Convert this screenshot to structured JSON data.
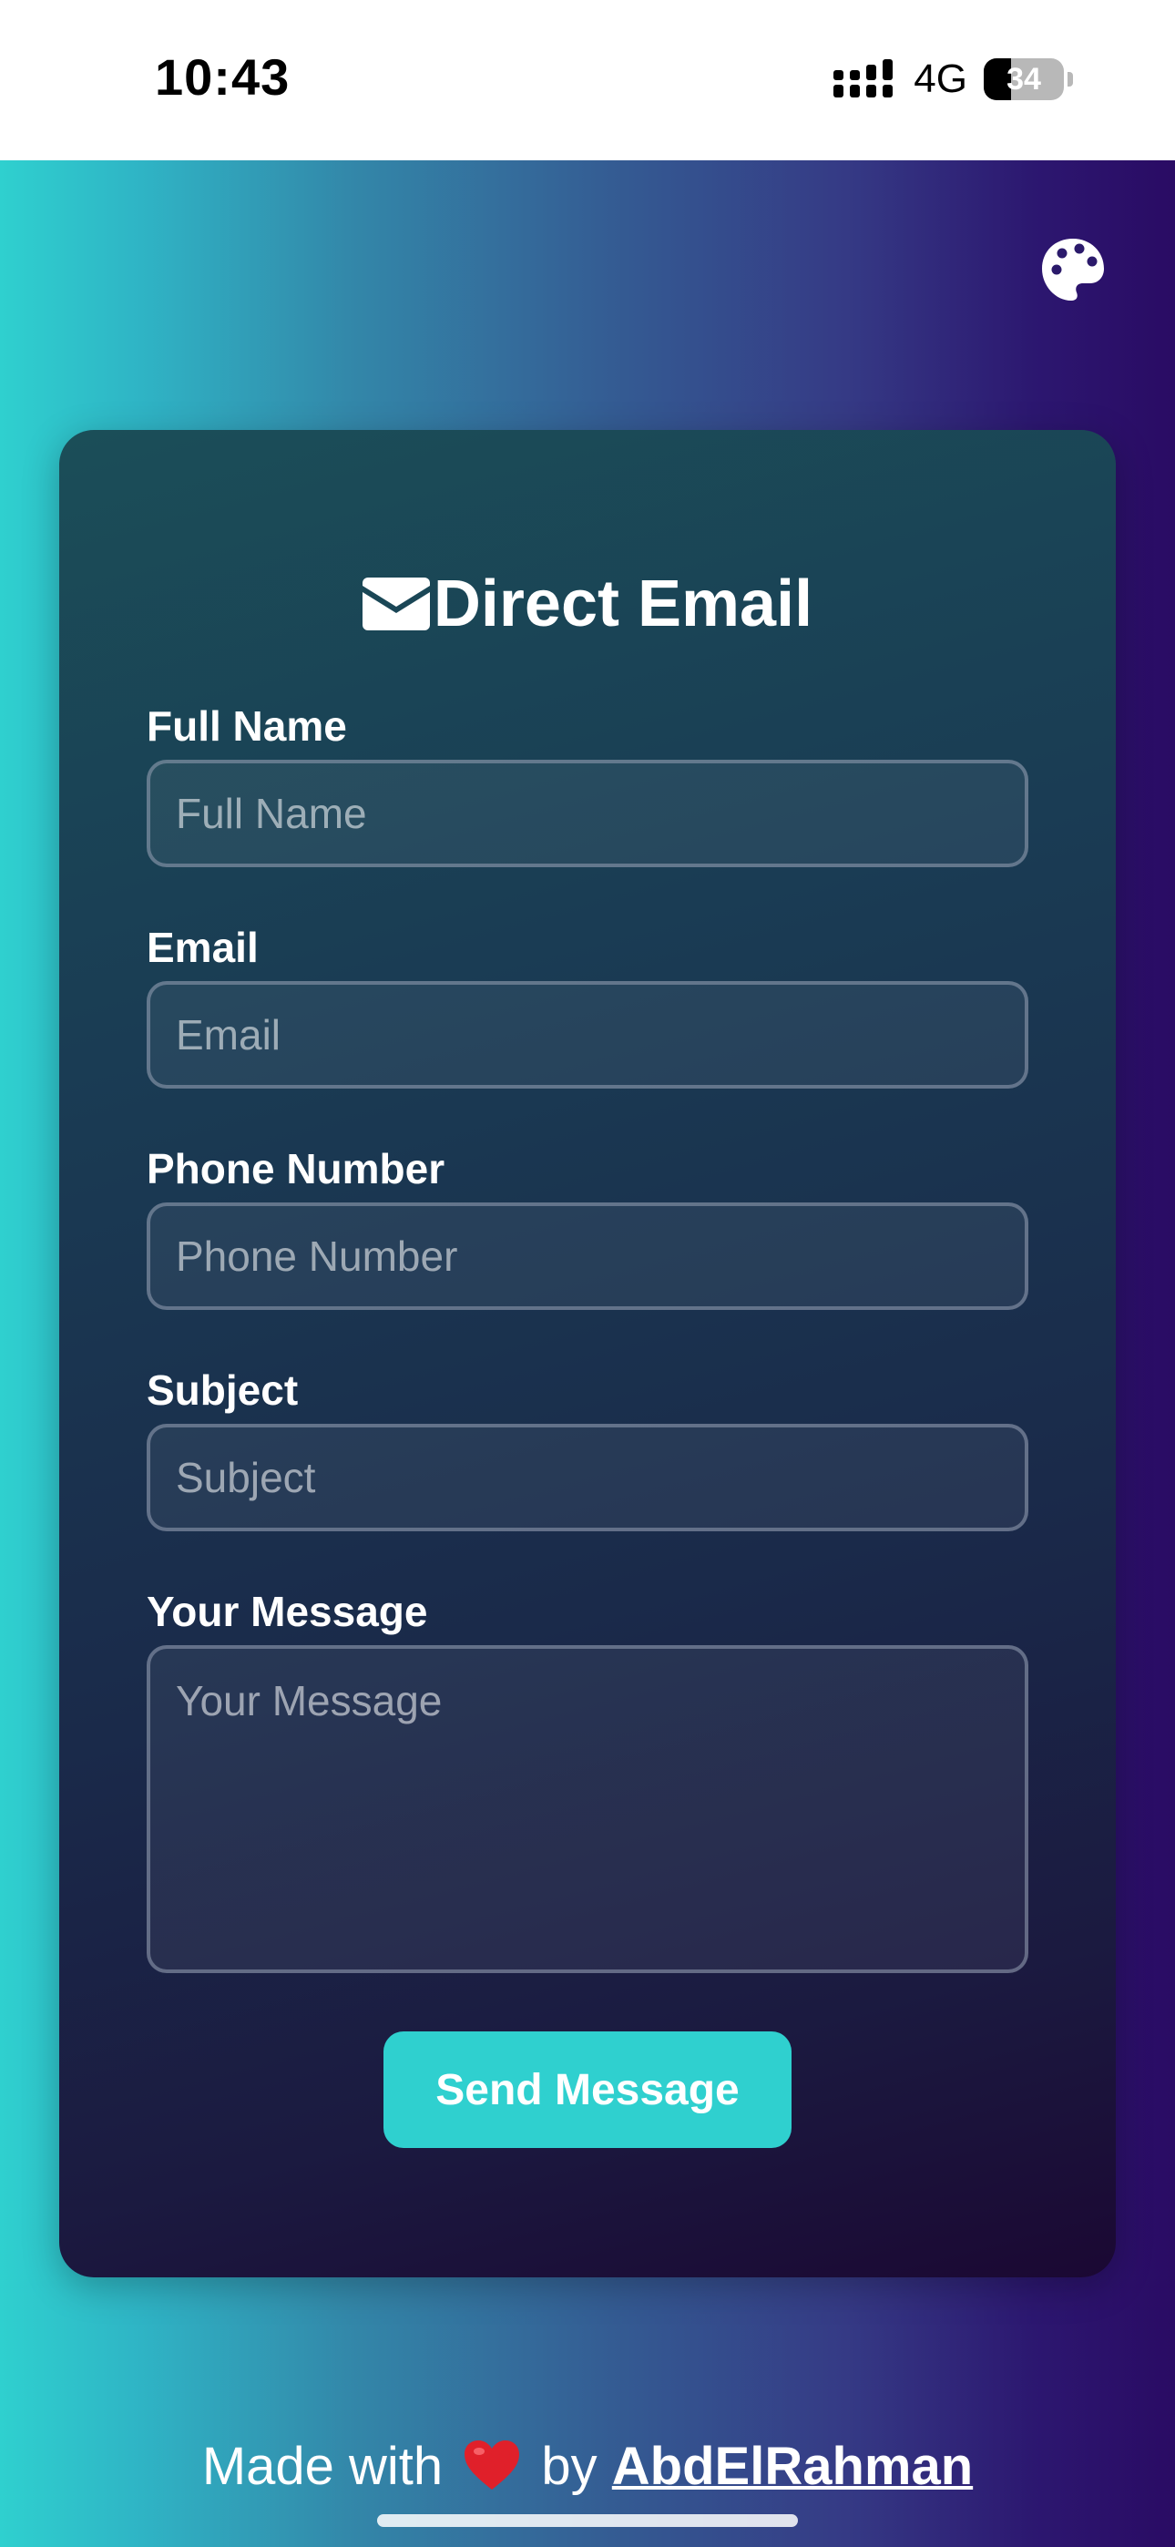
{
  "status_bar": {
    "time": "10:43",
    "network": "4G",
    "battery_level": "34",
    "battery_fraction": 0.34
  },
  "theme_toggle": {
    "icon": "palette-icon"
  },
  "form": {
    "title": "Direct Email",
    "title_icon": "envelope-icon",
    "fields": [
      {
        "label": "Full Name",
        "placeholder": "Full Name",
        "value": ""
      },
      {
        "label": "Email",
        "placeholder": "Email",
        "value": ""
      },
      {
        "label": "Phone Number",
        "placeholder": "Phone Number",
        "value": ""
      },
      {
        "label": "Subject",
        "placeholder": "Subject",
        "value": ""
      },
      {
        "label": "Your Message",
        "placeholder": "Your Message",
        "value": ""
      }
    ],
    "submit_label": "Send Message"
  },
  "footer": {
    "prefix": "Made with",
    "heart": "heart-icon",
    "middle": "by",
    "author": "AbdElRahman"
  },
  "colors": {
    "accent": "#2fd0cf",
    "gradient_left": "#2fd0cf",
    "gradient_right": "#2a0b64",
    "card_top": "#1b4e58",
    "card_bottom": "#1b0833"
  }
}
